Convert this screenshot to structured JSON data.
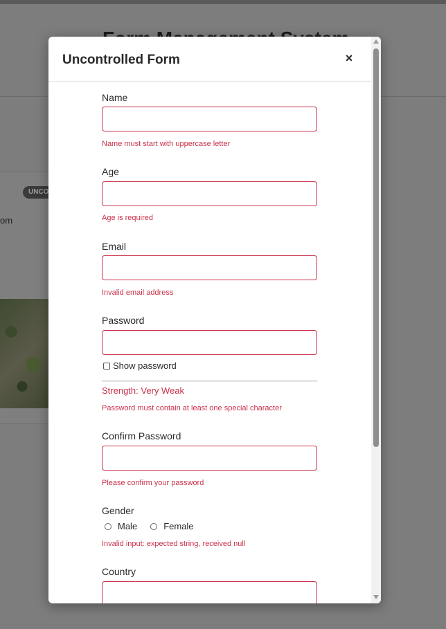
{
  "background": {
    "title": "Form Management System",
    "badge": "UNCO",
    "text": "om"
  },
  "modal": {
    "title": "Uncontrolled Form",
    "close_label": "×"
  },
  "form": {
    "name": {
      "label": "Name",
      "value": "",
      "placeholder": "",
      "error": "Name must start with uppercase letter"
    },
    "age": {
      "label": "Age",
      "value": "",
      "placeholder": "",
      "error": "Age is required"
    },
    "email": {
      "label": "Email",
      "value": "",
      "placeholder": "",
      "error": "Invalid email address"
    },
    "password": {
      "label": "Password",
      "value": "",
      "placeholder": "",
      "show_password_label": "Show password",
      "strength": "Strength: Very Weak",
      "error": "Password must contain at least one special character"
    },
    "confirm_password": {
      "label": "Confirm Password",
      "value": "",
      "placeholder": "",
      "error": "Please confirm your password"
    },
    "gender": {
      "label": "Gender",
      "options": [
        "Male",
        "Female"
      ],
      "error": "Invalid input: expected string, received null"
    },
    "country": {
      "label": "Country",
      "value": "",
      "placeholder": ""
    }
  },
  "colors": {
    "error": "#c9314a",
    "overlay": "#7d7d7d"
  }
}
